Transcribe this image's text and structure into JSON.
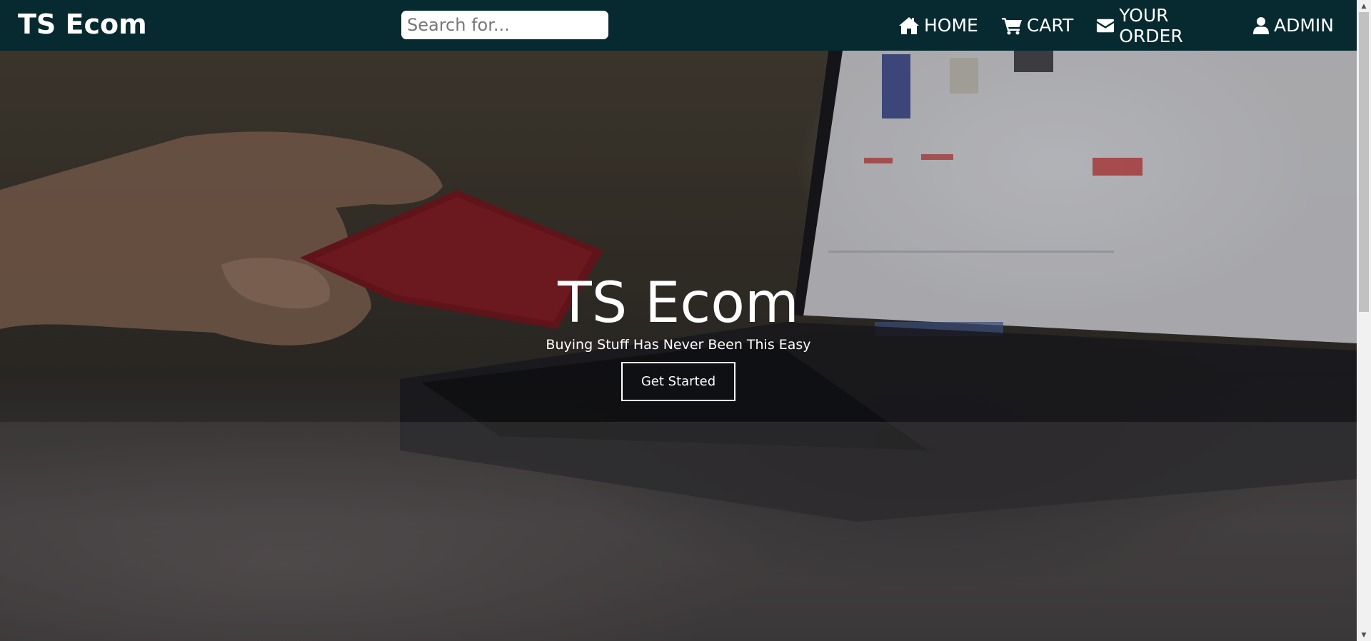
{
  "header": {
    "brand": "TS Ecom",
    "search_placeholder": "Search for...",
    "nav": [
      {
        "label": "HOME",
        "icon": "home-icon"
      },
      {
        "label": "CART",
        "icon": "cart-icon"
      },
      {
        "label": "YOUR ORDER",
        "icon": "envelope-icon"
      },
      {
        "label": "ADMIN",
        "icon": "user-icon"
      }
    ]
  },
  "hero": {
    "title": "TS Ecom",
    "subtitle": "Buying Stuff Has Never Been This Easy",
    "button_label": "Get Started"
  },
  "colors": {
    "navbar_bg": "#072930",
    "text": "#ffffff"
  }
}
